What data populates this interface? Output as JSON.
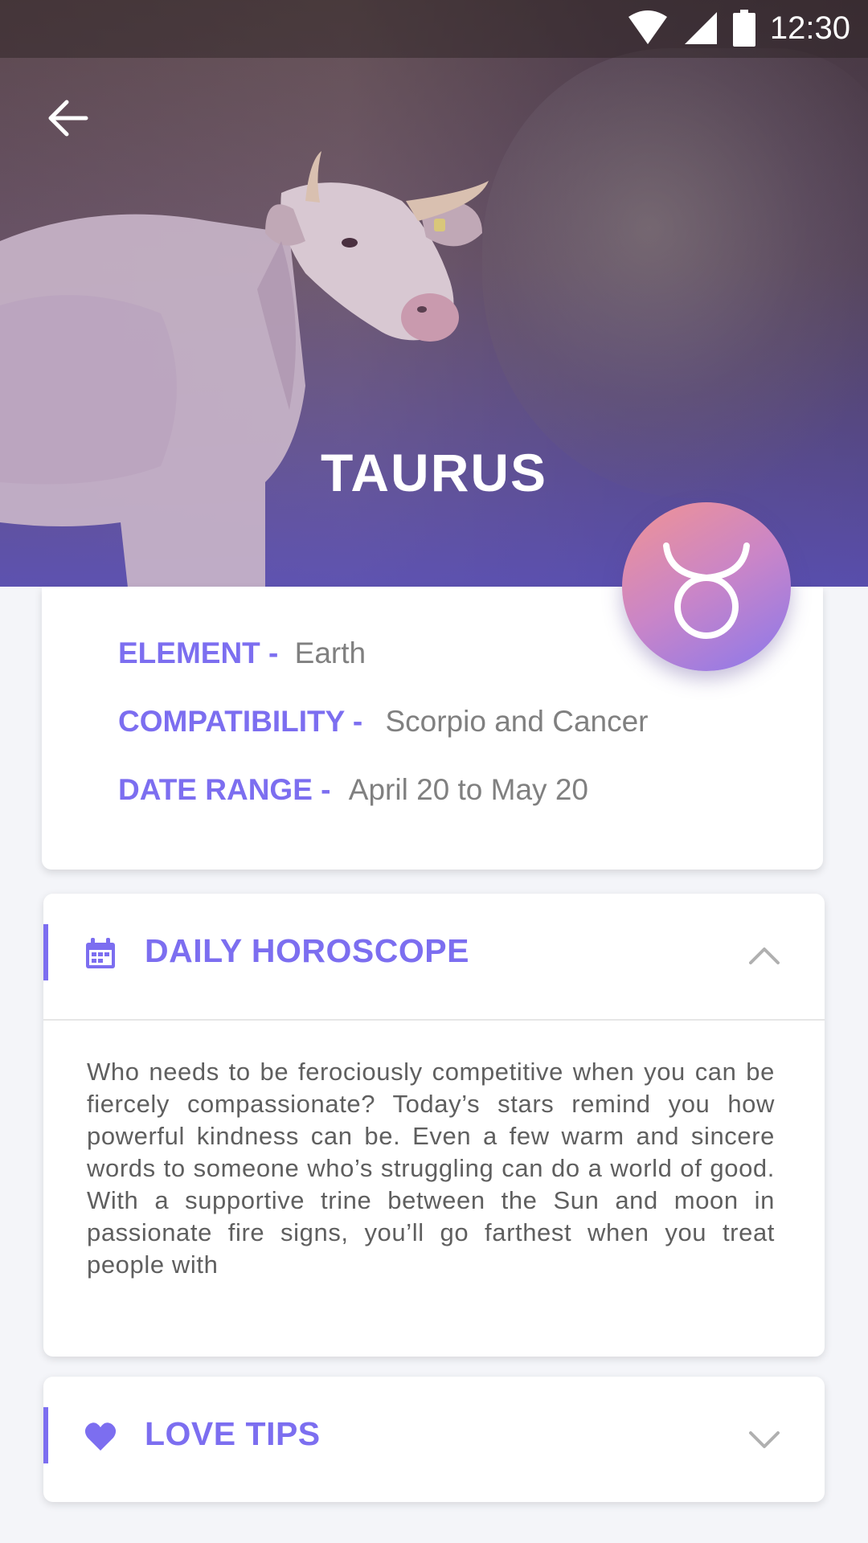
{
  "status_bar": {
    "time": "12:30",
    "icons": [
      "wifi-icon",
      "cell-signal-icon",
      "battery-icon"
    ]
  },
  "header": {
    "back_icon": "arrow-back-icon",
    "title": "TAURUS",
    "zodiac_symbol_icon": "taurus-symbol-icon"
  },
  "info": {
    "element": {
      "label": "ELEMENT -",
      "value": "Earth"
    },
    "compatibility": {
      "label": "COMPATIBILITY -",
      "value": "Scorpio and Cancer"
    },
    "date_range": {
      "label": "DATE RANGE -",
      "value": "April 20 to May 20"
    }
  },
  "daily_horoscope": {
    "icon": "calendar-icon",
    "title": "DAILY HOROSCOPE",
    "expanded": true,
    "text": "Who needs to be ferociously competitive when you can be fiercely compassionate? Today’s stars remind you how powerful kindness can be. Even a few warm and sincere words to someone who’s struggling can do a world of good. With a supportive trine between the Sun and moon in passionate fire signs, you’ll go farthest when you treat people with"
  },
  "love_tips": {
    "icon": "heart-icon",
    "title": "LOVE TIPS",
    "expanded": false
  },
  "colors": {
    "accent": "#7c6ef0",
    "badge_gradient_start": "#f19393",
    "badge_gradient_end": "#8a78ec",
    "value_text": "#808080",
    "body_text": "#5f5f5f"
  }
}
